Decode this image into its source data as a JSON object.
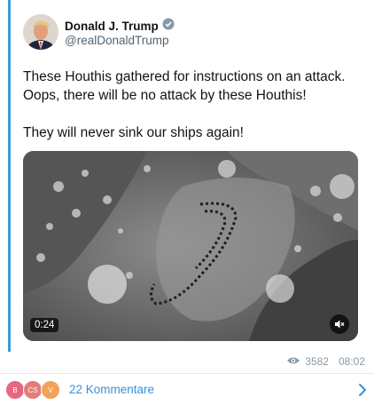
{
  "post": {
    "author_name": "Donald J. Trump",
    "author_handle": "@realDonaldTrump",
    "verified_icon": "verified-badge-icon",
    "text_lines": [
      "These Houthis gathered for instructions on an attack. Oops, there will be no attack by these Houthis!",
      "They will never sink our ships again!"
    ],
    "video": {
      "duration": "0:24",
      "mute_icon": "speaker-muted-icon"
    }
  },
  "meta": {
    "views_icon": "eye-icon",
    "views": "3582",
    "time": "08:02"
  },
  "comments": {
    "avatars": [
      {
        "label": "B",
        "color": "#e8667f"
      },
      {
        "label": "CS",
        "color": "#e57c7a"
      },
      {
        "label": "V",
        "color": "#f2a35b"
      }
    ],
    "label": "22 Kommentare",
    "chevron_icon": "chevron-right-icon"
  },
  "colors": {
    "accent": "#3a8fd9",
    "quote_bar": "#3a9ad9",
    "muted_text": "#536471"
  }
}
